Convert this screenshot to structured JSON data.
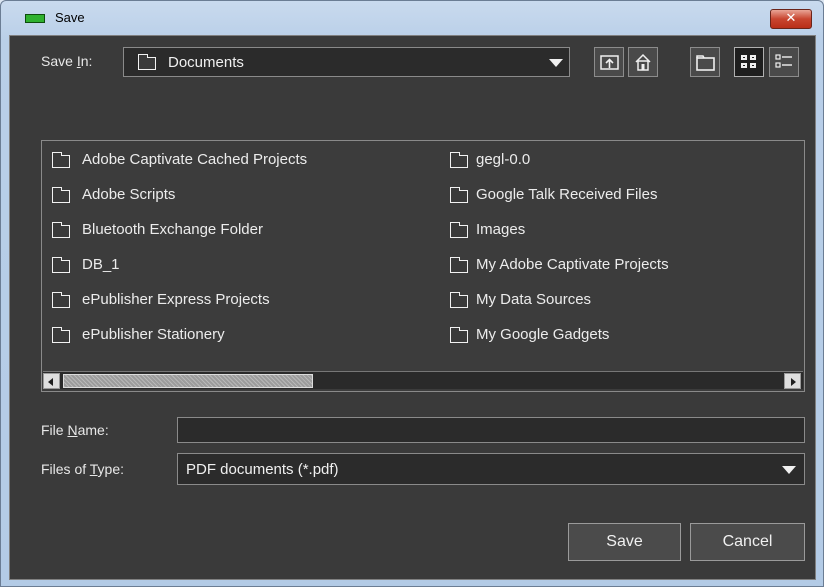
{
  "window": {
    "title": "Save",
    "close_glyph": "✕"
  },
  "toolbar": {
    "save_in_label": "Save In:",
    "save_in_value": "Documents",
    "buttons": [
      "up-one-level-icon",
      "home-icon",
      "new-folder-icon",
      "list-view-icon",
      "details-view-icon"
    ]
  },
  "files": {
    "col1": [
      "Adobe Captivate Cached Projects",
      "Adobe Scripts",
      "Bluetooth Exchange Folder",
      "DB_1",
      "ePublisher Express Projects",
      "ePublisher Stationery"
    ],
    "col2": [
      "gegl-0.0",
      "Google Talk Received Files",
      "Images",
      "My Adobe Captivate Projects",
      "My Data Sources",
      "My Google Gadgets"
    ]
  },
  "form": {
    "file_name_label": "File Name:",
    "file_name_value": "",
    "file_type_label": "Files of Type:",
    "file_type_value": "PDF documents (*.pdf)"
  },
  "actions": {
    "save_label": "Save",
    "cancel_label": "Cancel"
  }
}
